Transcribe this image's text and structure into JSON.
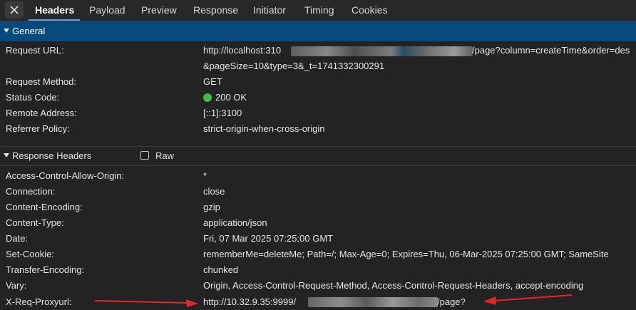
{
  "tabs": [
    {
      "label": "Headers",
      "active": true
    },
    {
      "label": "Payload"
    },
    {
      "label": "Preview"
    },
    {
      "label": "Response"
    },
    {
      "label": "Initiator"
    },
    {
      "label": "Timing"
    },
    {
      "label": "Cookies"
    }
  ],
  "general": {
    "title": "General",
    "rows": [
      {
        "key": "Request URL:",
        "value": "http://localhost:310",
        "value_tail": "/page?column=createTime&order=des",
        "value_line2": "&pageSize=10&type=3&_t=1741332300291"
      },
      {
        "key": "Request Method:",
        "value": "GET"
      },
      {
        "key": "Status Code:",
        "value": "200 OK"
      },
      {
        "key": "Remote Address:",
        "value": "[::1]:3100"
      },
      {
        "key": "Referrer Policy:",
        "value": "strict-origin-when-cross-origin"
      }
    ]
  },
  "response": {
    "title": "Response Headers",
    "raw_label": "Raw",
    "rows": [
      {
        "key": "Access-Control-Allow-Origin:",
        "value": "*"
      },
      {
        "key": "Connection:",
        "value": "close"
      },
      {
        "key": "Content-Encoding:",
        "value": "gzip"
      },
      {
        "key": "Content-Type:",
        "value": "application/json"
      },
      {
        "key": "Date:",
        "value": "Fri, 07 Mar 2025 07:25:00 GMT"
      },
      {
        "key": "Set-Cookie:",
        "value": "rememberMe=deleteMe; Path=/; Max-Age=0; Expires=Thu, 06-Mar-2025 07:25:00 GMT; SameSite"
      },
      {
        "key": "Transfer-Encoding:",
        "value": "chunked"
      },
      {
        "key": "Vary:",
        "value": "Origin, Access-Control-Request-Method, Access-Control-Request-Headers, accept-encoding"
      },
      {
        "key": "X-Req-Proxyurl:",
        "value": "http://10.32.9.35:9999/",
        "value_tail": "/page?"
      }
    ]
  },
  "colors": {
    "accent": "#5f9ee8",
    "section_header_bg": "#094a7d",
    "status_ok": "#3fb950",
    "annotation_arrow": "#e5262b"
  }
}
